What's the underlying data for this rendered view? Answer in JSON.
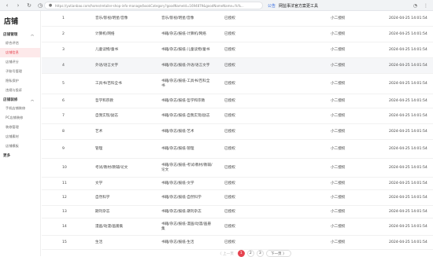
{
  "browser": {
    "url": "https://yutianbao.com/home/retailer-shop-info-manage/bookCategory?goodNameId=1694879&goodNameName=%%...",
    "notice_tag": "公告",
    "notice_text": "网监事法官方案更工具"
  },
  "sidebar": {
    "brand": "店铺",
    "groups": [
      {
        "label": "店铺管理",
        "items": [
          "综合评估",
          "店铺信息",
          "店铺评分",
          "子账号管理",
          "隐私保护",
          "违规与投诉"
        ]
      },
      {
        "label": "店铺装修",
        "items": [
          "手机店铺装修",
          "PC店铺装修",
          "装修管理",
          "店铺素材",
          "店铺模板"
        ]
      }
    ],
    "more": "更多"
  },
  "rows": [
    {
      "num": "1",
      "name": "音乐/影视/明星/音像",
      "path": "音乐/影视/明星/音像",
      "status": "已授权",
      "author": "小二授权",
      "time": "2024-04-25 14:01:54"
    },
    {
      "num": "2",
      "name": "计算机/网络",
      "path": "书籍/杂志/报纸-计算机/网络",
      "status": "已授权",
      "author": "小二授权",
      "time": "2024-04-25 14:01:54"
    },
    {
      "num": "3",
      "name": "儿童读物/童书",
      "path": "书籍/杂志/报纸-儿童读物/童书",
      "status": "已授权",
      "author": "小二授权",
      "time": "2024-04-25 14:01:54"
    },
    {
      "num": "4",
      "name": "外语/语言文字",
      "path": "书籍/杂志/报纸-外语/语言文字",
      "status": "已授权",
      "author": "小二授权",
      "time": "2024-04-25 14:01:54"
    },
    {
      "num": "5",
      "name": "工具书/百科全书",
      "path": "书籍/杂志/报纸-工具书/百科全书",
      "status": "已授权",
      "author": "小二授权",
      "time": "2024-04-25 14:01:54"
    },
    {
      "num": "6",
      "name": "哲学和宗教",
      "path": "书籍/杂志/报纸-哲学和宗教",
      "status": "已授权",
      "author": "小二授权",
      "time": "2024-04-25 14:01:54"
    },
    {
      "num": "7",
      "name": "自我实现/励志",
      "path": "书籍/杂志/报纸-自我实现/励志",
      "status": "已授权",
      "author": "小二授权",
      "time": "2024-04-25 14:01:54"
    },
    {
      "num": "8",
      "name": "艺术",
      "path": "书籍/杂志/报纸-艺术",
      "status": "已授权",
      "author": "小二授权",
      "time": "2024-04-25 14:01:54"
    },
    {
      "num": "9",
      "name": "管理",
      "path": "书籍/杂志/报纸-管理",
      "status": "已授权",
      "author": "小二授权",
      "time": "2024-04-25 14:01:54"
    },
    {
      "num": "10",
      "name": "考试/教材/教辅/论文",
      "path": "书籍/杂志/报纸-考试/教材/教辅/论文",
      "status": "已授权",
      "author": "小二授权",
      "time": "2024-04-25 14:01:54"
    },
    {
      "num": "11",
      "name": "文学",
      "path": "书籍/杂志/报纸-文学",
      "status": "已授权",
      "author": "小二授权",
      "time": "2024-04-25 14:01:54"
    },
    {
      "num": "12",
      "name": "自然科学",
      "path": "书籍/杂志/报纸-自然科学",
      "status": "已授权",
      "author": "小二授权",
      "time": "2024-04-25 14:01:54"
    },
    {
      "num": "13",
      "name": "期刊杂志",
      "path": "书籍/杂志/报纸-期刊杂志",
      "status": "已授权",
      "author": "小二授权",
      "time": "2024-04-25 14:01:54"
    },
    {
      "num": "14",
      "name": "漫画/动漫/画册集",
      "path": "书籍/杂志/报纸-漫画/动漫/画册集",
      "status": "已授权",
      "author": "小二授权",
      "time": "2024-04-25 14:01:54"
    },
    {
      "num": "15",
      "name": "生活",
      "path": "书籍/杂志/报纸-生活",
      "status": "已授权",
      "author": "小二授权",
      "time": "2024-04-25 14:01:54"
    }
  ],
  "pagination": {
    "prev": "〈 上一页",
    "pages": [
      "1",
      "2",
      "3"
    ],
    "current": "1",
    "next": "下一页 〉"
  },
  "colors": {
    "accent": "#e5434f",
    "link": "#3a6fe0"
  }
}
